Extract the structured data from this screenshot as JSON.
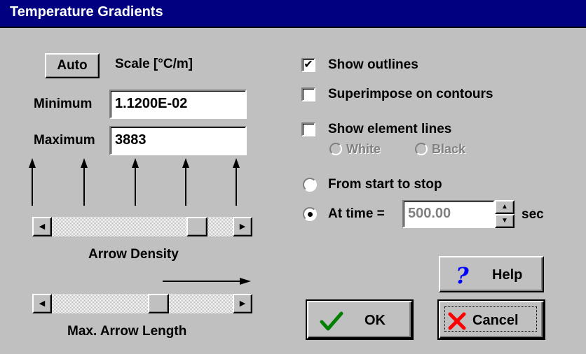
{
  "window": {
    "title": "Temperature Gradients"
  },
  "scale": {
    "auto_label": "Auto",
    "title": "Scale [°C/m]",
    "min_label": "Minimum",
    "min_value": "1.1200E-02",
    "max_label": "Maximum",
    "max_value": "3883"
  },
  "density": {
    "label": "Arrow Density",
    "level": 0.84
  },
  "length": {
    "label": "Max. Arrow Length",
    "level": 0.6
  },
  "options": {
    "show_outlines": {
      "label": "Show outlines",
      "checked": true
    },
    "superimpose": {
      "label": "Superimpose on contours",
      "checked": false
    },
    "element_lines": {
      "label": "Show element lines",
      "checked": false
    },
    "white_label": "White",
    "black_label": "Black"
  },
  "time": {
    "from_start_label": "From start to stop",
    "at_time_label": "At time =",
    "value": "500.00",
    "unit": "sec",
    "selected": "at_time"
  },
  "buttons": {
    "help": "Help",
    "ok": "OK",
    "cancel": "Cancel"
  },
  "icons": {
    "help": "question-mark-icon",
    "ok": "check-mark-icon",
    "cancel": "x-mark-icon"
  },
  "colors": {
    "title_bar": "#000080",
    "help_icon": "#0000ff",
    "ok_icon": "#008000",
    "cancel_icon": "#ff0000"
  }
}
